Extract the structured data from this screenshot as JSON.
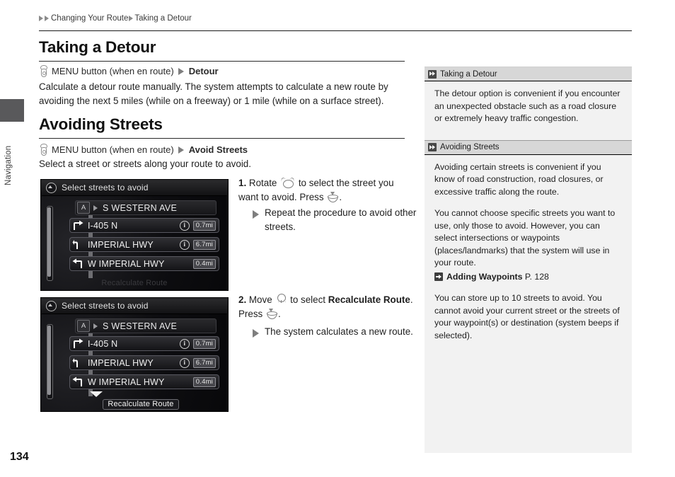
{
  "side_tab": {
    "label": "Navigation"
  },
  "breadcrumb": {
    "parent": "Changing Your Route",
    "current": "Taking a Detour"
  },
  "page_number": "134",
  "sections": {
    "detour": {
      "heading": "Taking a Detour",
      "menu_prefix": "MENU button (when en route)",
      "menu_target": "Detour",
      "press_icon": "press-button-icon",
      "arrow_icon": "triangle-right-icon",
      "body": "Calculate a detour route manually. The system attempts to calculate a new route by avoiding the next 5 miles (while on a freeway) or 1 mile (while on a surface street)."
    },
    "avoid": {
      "heading": "Avoiding Streets",
      "menu_prefix": "MENU button (when en route)",
      "menu_target": "Avoid Streets",
      "body": "Select a street or streets along your route to avoid."
    }
  },
  "steps": [
    {
      "num": "1.",
      "text_a": "Rotate",
      "icon_a": "rotate-knob-icon",
      "text_b": "to select the street you want to avoid. Press",
      "icon_b": "press-knob-icon",
      "text_c": ".",
      "bullet": "Repeat the procedure to avoid other streets."
    },
    {
      "num": "2.",
      "text_a": "Move",
      "icon_a": "move-knob-down-icon",
      "text_b": "to select",
      "bold_target": "Recalculate Route",
      "text_c": ". Press",
      "icon_b": "press-knob-icon",
      "text_d": ".",
      "bullet": "The system calculates a new route."
    }
  ],
  "nav_screens": [
    {
      "title": "Select streets to avoid",
      "title_icon": "home-compass-icon",
      "header_row": {
        "badge": "A",
        "flag_icon": "flag-icon",
        "name": "S WESTERN AVE"
      },
      "items": [
        {
          "turn_icon": "turn-right-icon",
          "name": "I-405 N",
          "info_icon": "info-icon",
          "has_info": true,
          "distance": "0.7mi"
        },
        {
          "turn_icon": "turn-slight-left-icon",
          "name": "IMPERIAL HWY",
          "info_icon": "info-icon",
          "has_info": true,
          "distance": "6.7mi"
        },
        {
          "turn_icon": "turn-left-icon",
          "name": "W IMPERIAL HWY",
          "has_info": false,
          "distance": "0.4mi"
        }
      ],
      "footer_label": "Recalculate Route",
      "footer_highlighted": false,
      "footer_chevron": false
    },
    {
      "title": "Select streets to avoid",
      "title_icon": "home-compass-icon",
      "header_row": {
        "badge": "A",
        "flag_icon": "flag-icon",
        "name": "S WESTERN AVE"
      },
      "items": [
        {
          "turn_icon": "turn-right-icon",
          "name": "I-405 N",
          "info_icon": "info-icon",
          "has_info": true,
          "distance": "0.7mi"
        },
        {
          "turn_icon": "turn-slight-left-icon",
          "name": "IMPERIAL HWY",
          "info_icon": "info-icon",
          "has_info": true,
          "distance": "6.7mi"
        },
        {
          "turn_icon": "turn-left-icon",
          "name": "W IMPERIAL HWY",
          "has_info": false,
          "distance": "0.4mi"
        }
      ],
      "footer_label": "Recalculate Route",
      "footer_highlighted": true,
      "footer_chevron": true
    }
  ],
  "sidebar": {
    "blocks": [
      {
        "title": "Taking a Detour",
        "paragraphs": [
          "The detour option is convenient if you encounter an unexpected obstacle such as a road closure or extremely heavy traffic congestion."
        ]
      },
      {
        "title": "Avoiding Streets",
        "paragraphs": [
          "Avoiding certain streets is convenient if you know of road construction, road closures, or excessive traffic along the route.",
          "You cannot choose specific streets you want to use, only those to avoid. However, you can select intersections or waypoints (places/landmarks) that the system will use in your route.",
          "You can store up to 10 streets to avoid. You cannot avoid your current street or the streets of your waypoint(s) or destination (system beeps if selected)."
        ],
        "reference": {
          "title": "Adding Waypoints",
          "page": "P. 128"
        }
      }
    ]
  },
  "colors": {
    "sidebar_bg": "#f2f2f2",
    "sidebar_head": "#d7d7d7",
    "tab": "#59595b"
  }
}
